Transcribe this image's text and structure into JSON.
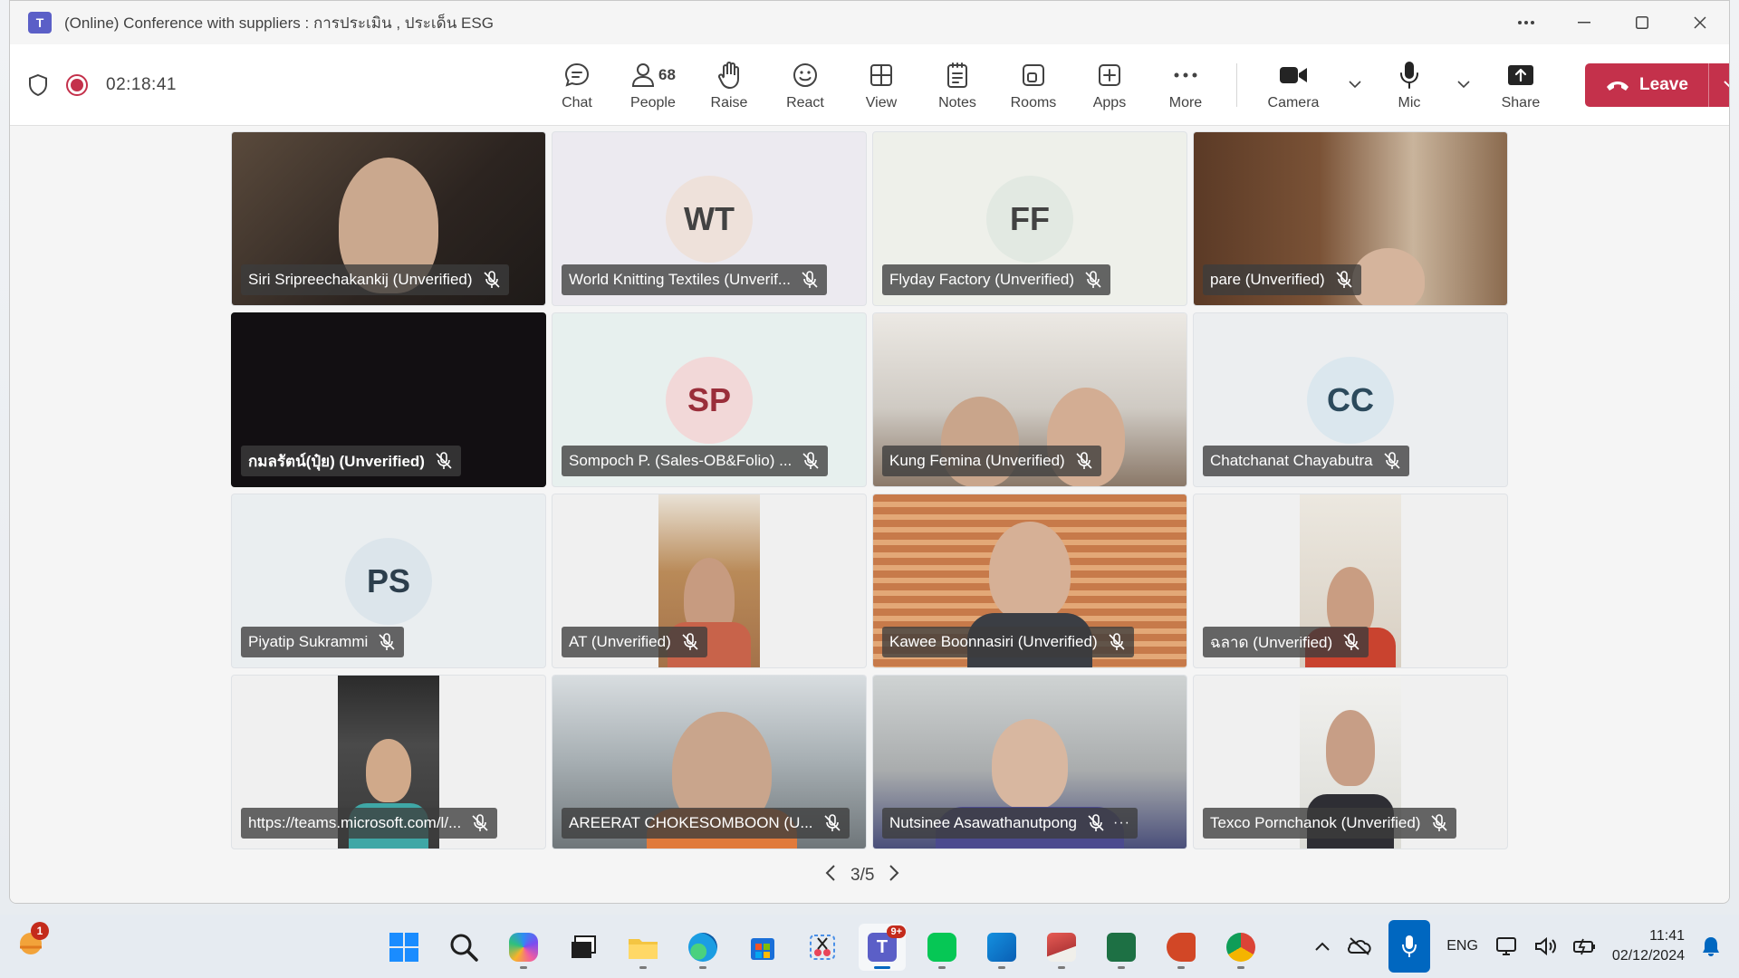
{
  "window": {
    "title": "(Online) Conference with suppliers : การประเมิน , ประเด็น ESG",
    "app_logo_letter": "T"
  },
  "toolbar": {
    "timer": "02:18:41",
    "chat": "Chat",
    "people": "People",
    "people_count": "68",
    "raise": "Raise",
    "react": "React",
    "view": "View",
    "notes": "Notes",
    "rooms": "Rooms",
    "apps": "Apps",
    "more": "More",
    "camera": "Camera",
    "mic": "Mic",
    "share": "Share",
    "leave": "Leave"
  },
  "participants": [
    {
      "name": "Siri Sripreechakankij (Unverified)",
      "type": "video"
    },
    {
      "name": "World Knitting Textiles (Unverif...",
      "type": "avatar",
      "initials": "WT",
      "color": "#efe3dc"
    },
    {
      "name": "Flyday Factory (Unverified)",
      "type": "avatar",
      "initials": "FF",
      "color": "#e3ebe4"
    },
    {
      "name": "pare (Unverified)",
      "type": "video"
    },
    {
      "name": "กมลรัตน์(ปุ๋ย) (Unverified)",
      "type": "dark"
    },
    {
      "name": "Sompoch P. (Sales-OB&Folio) ...",
      "type": "avatar",
      "initials": "SP",
      "color": "#f2d9d9"
    },
    {
      "name": "Kung Femina (Unverified)",
      "type": "video"
    },
    {
      "name": "Chatchanat Chayabutra",
      "type": "avatar",
      "initials": "CC",
      "color": "#dde8ee"
    },
    {
      "name": "Piyatip Sukrammi",
      "type": "avatar",
      "initials": "PS",
      "color": "#dde6ec"
    },
    {
      "name": "AT (Unverified)",
      "type": "video-narrow"
    },
    {
      "name": "Kawee Boonnasiri (Unverified)",
      "type": "video"
    },
    {
      "name": "ฉลาด (Unverified)",
      "type": "video-narrow"
    },
    {
      "name": "https://teams.microsoft.com/l/...",
      "type": "video-narrow"
    },
    {
      "name": "AREERAT CHOKESOMBOON (U...",
      "type": "video"
    },
    {
      "name": "Nutsinee Asawathanutpong",
      "type": "video",
      "more": "···"
    },
    {
      "name": "Texco Pornchanok (Unverified)",
      "type": "video-narrow"
    }
  ],
  "pager": {
    "label": "3/5"
  },
  "taskbar": {
    "weather_badge": "1",
    "teams_badge": "9+",
    "language": "ENG",
    "time": "11:41",
    "date": "02/12/2024"
  },
  "colors": {
    "leave": "#c4314b",
    "record": "#c4314b",
    "accent": "#0067c0"
  }
}
